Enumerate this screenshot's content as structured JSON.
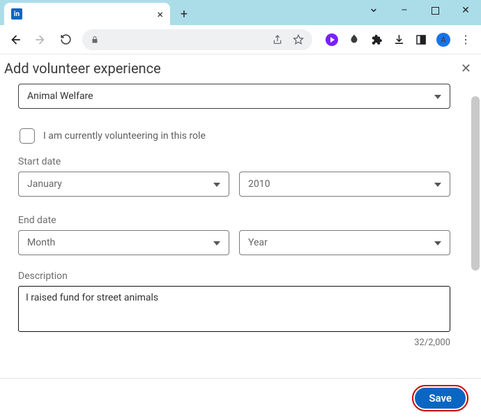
{
  "browser": {
    "favicon_text": "in",
    "avatar_letter": "A"
  },
  "modal": {
    "title": "Add volunteer experience"
  },
  "form": {
    "cause_value": "Animal Welfare",
    "currently_volunteering_label": "I am currently volunteering in this role",
    "start_date_label": "Start date",
    "start_month_value": "January",
    "start_year_value": "2010",
    "end_date_label": "End date",
    "end_month_placeholder": "Month",
    "end_year_placeholder": "Year",
    "description_label": "Description",
    "description_value": "I raised fund for street animals",
    "char_counter": "32/2,000",
    "save_label": "Save"
  }
}
